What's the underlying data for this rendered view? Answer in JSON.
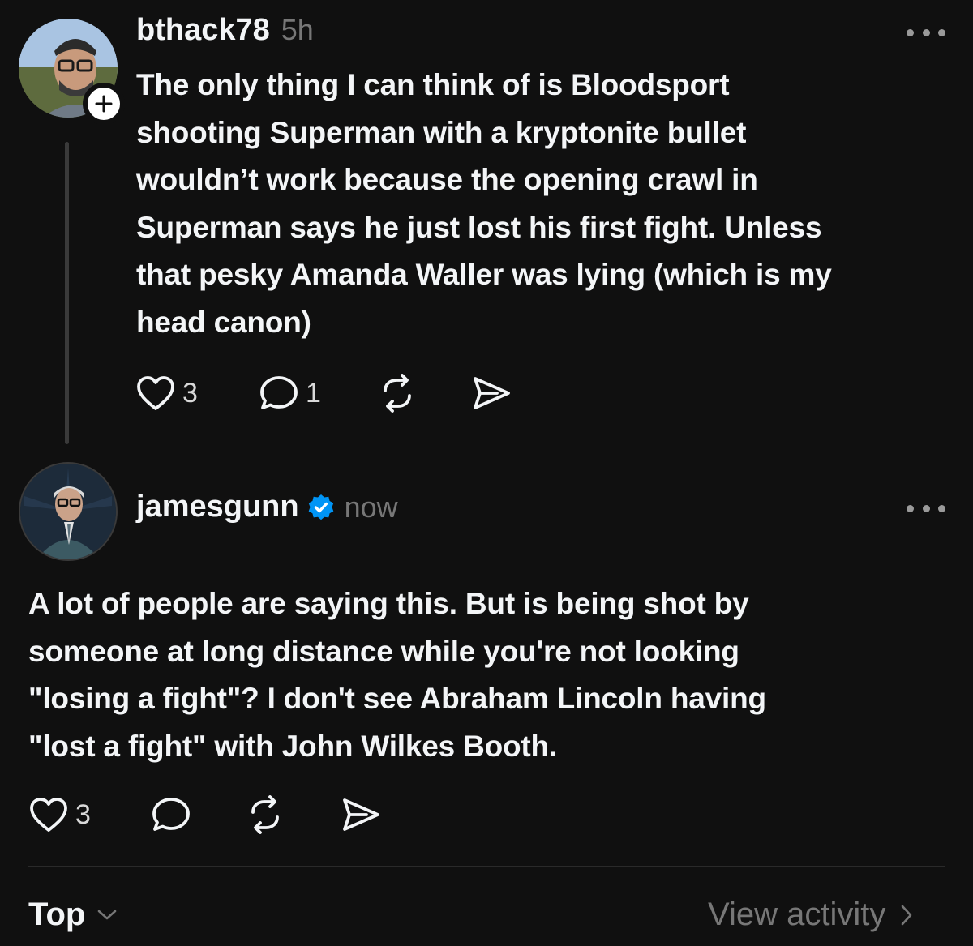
{
  "post1": {
    "username": "bthack78",
    "time": "5h",
    "lines": [
      "The only thing I can think of is Bloodsport",
      "shooting Superman with a kryptonite bullet",
      "wouldn’t work because the opening crawl in",
      "Superman says he just lost his first fight. Unless",
      "that pesky Amanda Waller was lying (which is my",
      "head canon)"
    ],
    "likes": "3",
    "replies": "1",
    "icons": [
      "heart-icon",
      "comment-icon",
      "repost-icon",
      "share-icon",
      "more-icon",
      "plus-icon"
    ]
  },
  "post2": {
    "username": "jamesgunn",
    "verified": true,
    "time": "now",
    "lines": [
      "A lot of people are saying this. But is being shot by",
      "someone at long distance while you're not looking",
      "\"losing a fight\"? I don't see Abraham Lincoln having",
      "\"lost a fight\" with John Wilkes Booth."
    ],
    "likes": "3",
    "icons": [
      "heart-icon",
      "comment-icon",
      "repost-icon",
      "share-icon",
      "more-icon",
      "verified-icon"
    ]
  },
  "footer": {
    "sort_label": "Top",
    "activity_label": "View activity"
  },
  "colors": {
    "background": "#101010",
    "text": "#f3f5f7",
    "muted": "#777777",
    "verified": "#0095f6"
  }
}
